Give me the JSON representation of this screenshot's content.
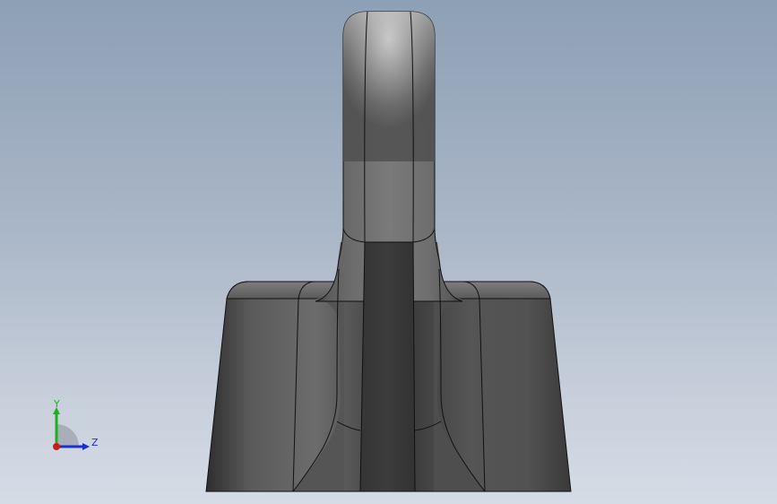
{
  "viewport": {
    "background_top": "#8ea0b5",
    "background_bottom": "#d6dce6"
  },
  "model": {
    "name": "3d-part",
    "body_color": "#4a4a4a",
    "highlight_color": "#d0d0d0",
    "edge_color": "#101010"
  },
  "triad": {
    "y_label": "Y",
    "z_label": "Z",
    "y_color": "#1fae1f",
    "z_color": "#1a2fd0",
    "x_color": "#d01a1a"
  }
}
